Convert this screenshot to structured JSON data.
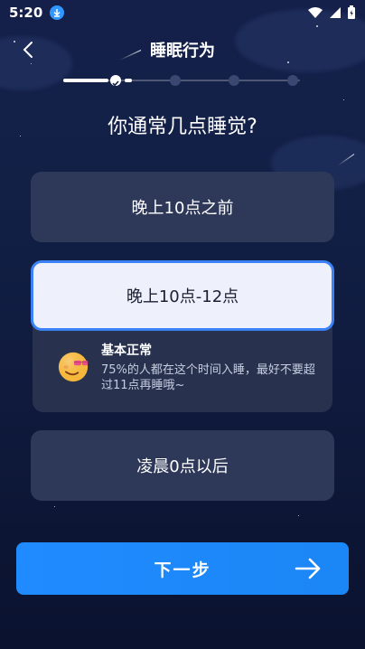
{
  "status_bar": {
    "time": "5:20"
  },
  "header": {
    "title": "睡眠行为"
  },
  "progress": {
    "steps_total": 4,
    "current_step": 1,
    "fraction": 0.22
  },
  "question": "你通常几点睡觉?",
  "options": [
    {
      "label": "晚上10点之前",
      "selected": false
    },
    {
      "label": "晚上10点-12点",
      "selected": true
    },
    {
      "label": "凌晨0点以后",
      "selected": false
    }
  ],
  "feedback": {
    "title": "基本正常",
    "desc": "75%的人都在这个时间入睡，最好不要超过11点再睡哦~",
    "icon": "sunglasses-emoji-icon"
  },
  "next_button": {
    "label": "下一步"
  },
  "colors": {
    "accent": "#1f8bff",
    "selected_border": "#3b82f6",
    "card": "#2e3858"
  }
}
